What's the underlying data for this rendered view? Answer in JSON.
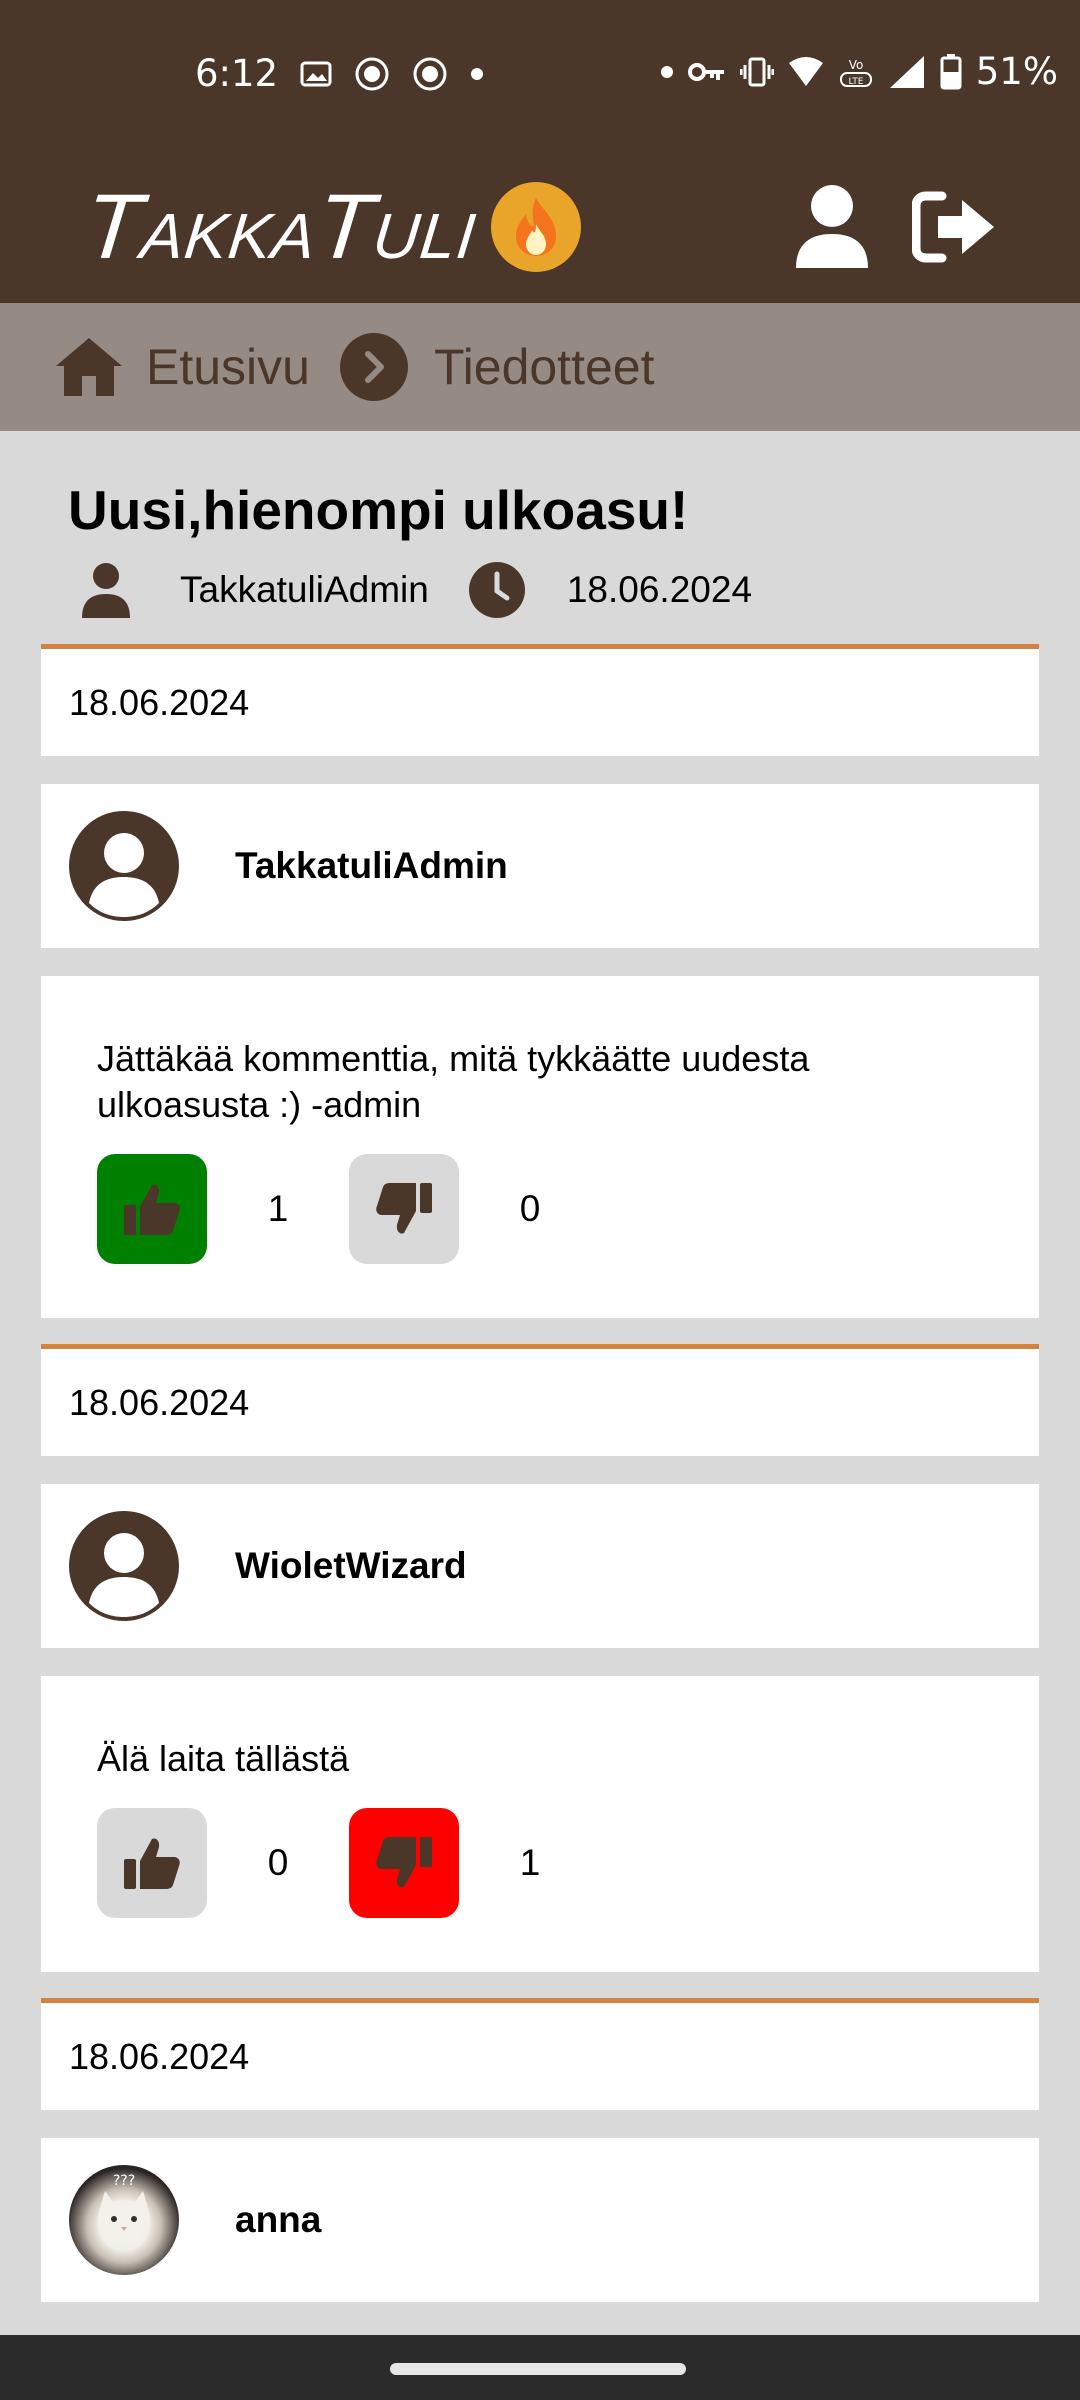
{
  "status_bar": {
    "time": "6:12",
    "battery": "51%",
    "icons": [
      "image-icon",
      "app-icon",
      "app-icon",
      "dot-icon",
      "dot-icon",
      "key-icon",
      "vibrate-icon",
      "wifi-icon",
      "volte-icon",
      "signal-icon",
      "battery-icon"
    ]
  },
  "header": {
    "logo_text": "TakkaTuli",
    "colors": {
      "brand": "#4b362a",
      "flame": "#e8a52a",
      "accent": "#d4823e"
    }
  },
  "breadcrumb": {
    "home": "Etusivu",
    "current": "Tiedotteet"
  },
  "post": {
    "title": "Uusi,hienompi ulkoasu!",
    "author": "TakkatuliAdmin",
    "date": "18.06.2024"
  },
  "comments": [
    {
      "date": "18.06.2024",
      "user": "TakkatuliAdmin",
      "text": "Jättäkää kommenttia, mitä tykkäätte uudesta ulkoasusta :) -admin",
      "likes": "1",
      "dislikes": "0",
      "vote_state": "liked"
    },
    {
      "date": "18.06.2024",
      "user": "WioletWizard",
      "text": "Älä laita tällästä",
      "likes": "0",
      "dislikes": "1",
      "vote_state": "disliked"
    },
    {
      "date": "18.06.2024",
      "user": "anna"
    }
  ]
}
